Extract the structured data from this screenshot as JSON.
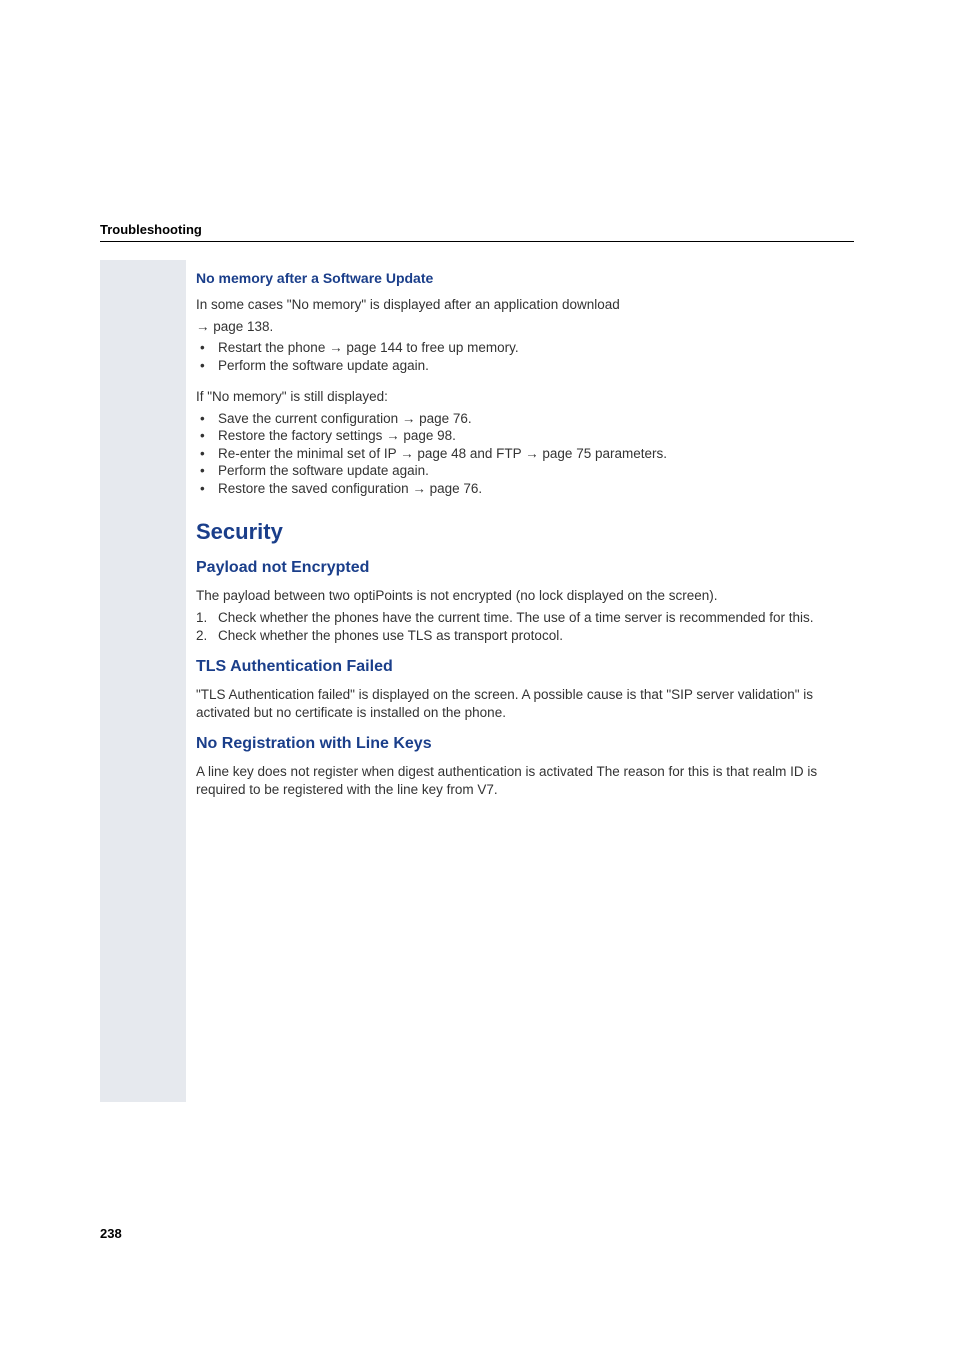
{
  "header": {
    "title": "Troubleshooting"
  },
  "section1": {
    "heading": "No memory after a Software Update",
    "intro_line1": "In some cases \"No memory\" is displayed after an application download",
    "intro_line2": "→ page 138.",
    "bullets1": [
      "Restart the phone → page 144 to free up memory.",
      "Perform the software update again."
    ],
    "cond_line": "If \"No memory\" is still displayed:",
    "bullets2": [
      "Save the current configuration → page 76.",
      "Restore the factory settings → page 98.",
      "Re-enter the minimal set of IP → page 48 and FTP → page 75 parameters.",
      "Perform the software update again.",
      "Restore the saved configuration → page 76."
    ]
  },
  "security": {
    "heading": "Security",
    "payload": {
      "heading": "Payload not Encrypted",
      "intro": "The payload between two optiPoints is not encrypted (no lock displayed on the screen).",
      "steps": [
        "Check whether the phones have the current time. The use of a time server is recommended for this.",
        "Check whether the phones use TLS as transport protocol."
      ]
    },
    "tls": {
      "heading": "TLS Authentication Failed",
      "body": "\"TLS Authentication failed\" is displayed on the screen. A possible cause is that \"SIP server validation\" is activated but no certificate is installed on the phone."
    },
    "noreg": {
      "heading": "No Registration with Line Keys",
      "body": "A line key does not register when digest authentication is activated The reason for this is that realm ID is required to be registered with the line key from V7."
    }
  },
  "page_number": "238"
}
